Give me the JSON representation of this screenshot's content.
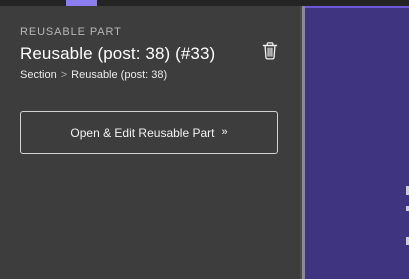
{
  "panel": {
    "eyebrow": "REUSABLE PART",
    "title": "Reusable (post: 38) (#33)",
    "breadcrumb": {
      "first": "Section",
      "separator": ">",
      "current": "Reusable (post: 38)"
    },
    "open_button": {
      "label": "Open & Edit Reusable Part",
      "chevron": "»"
    },
    "delete_icon": "trash-icon"
  },
  "colors": {
    "panel_bg": "#3d3d3d",
    "preview_bg": "#3e347f",
    "accent": "#8b7cf0",
    "text_primary": "#ffffff",
    "text_secondary": "#b7b7b7"
  }
}
